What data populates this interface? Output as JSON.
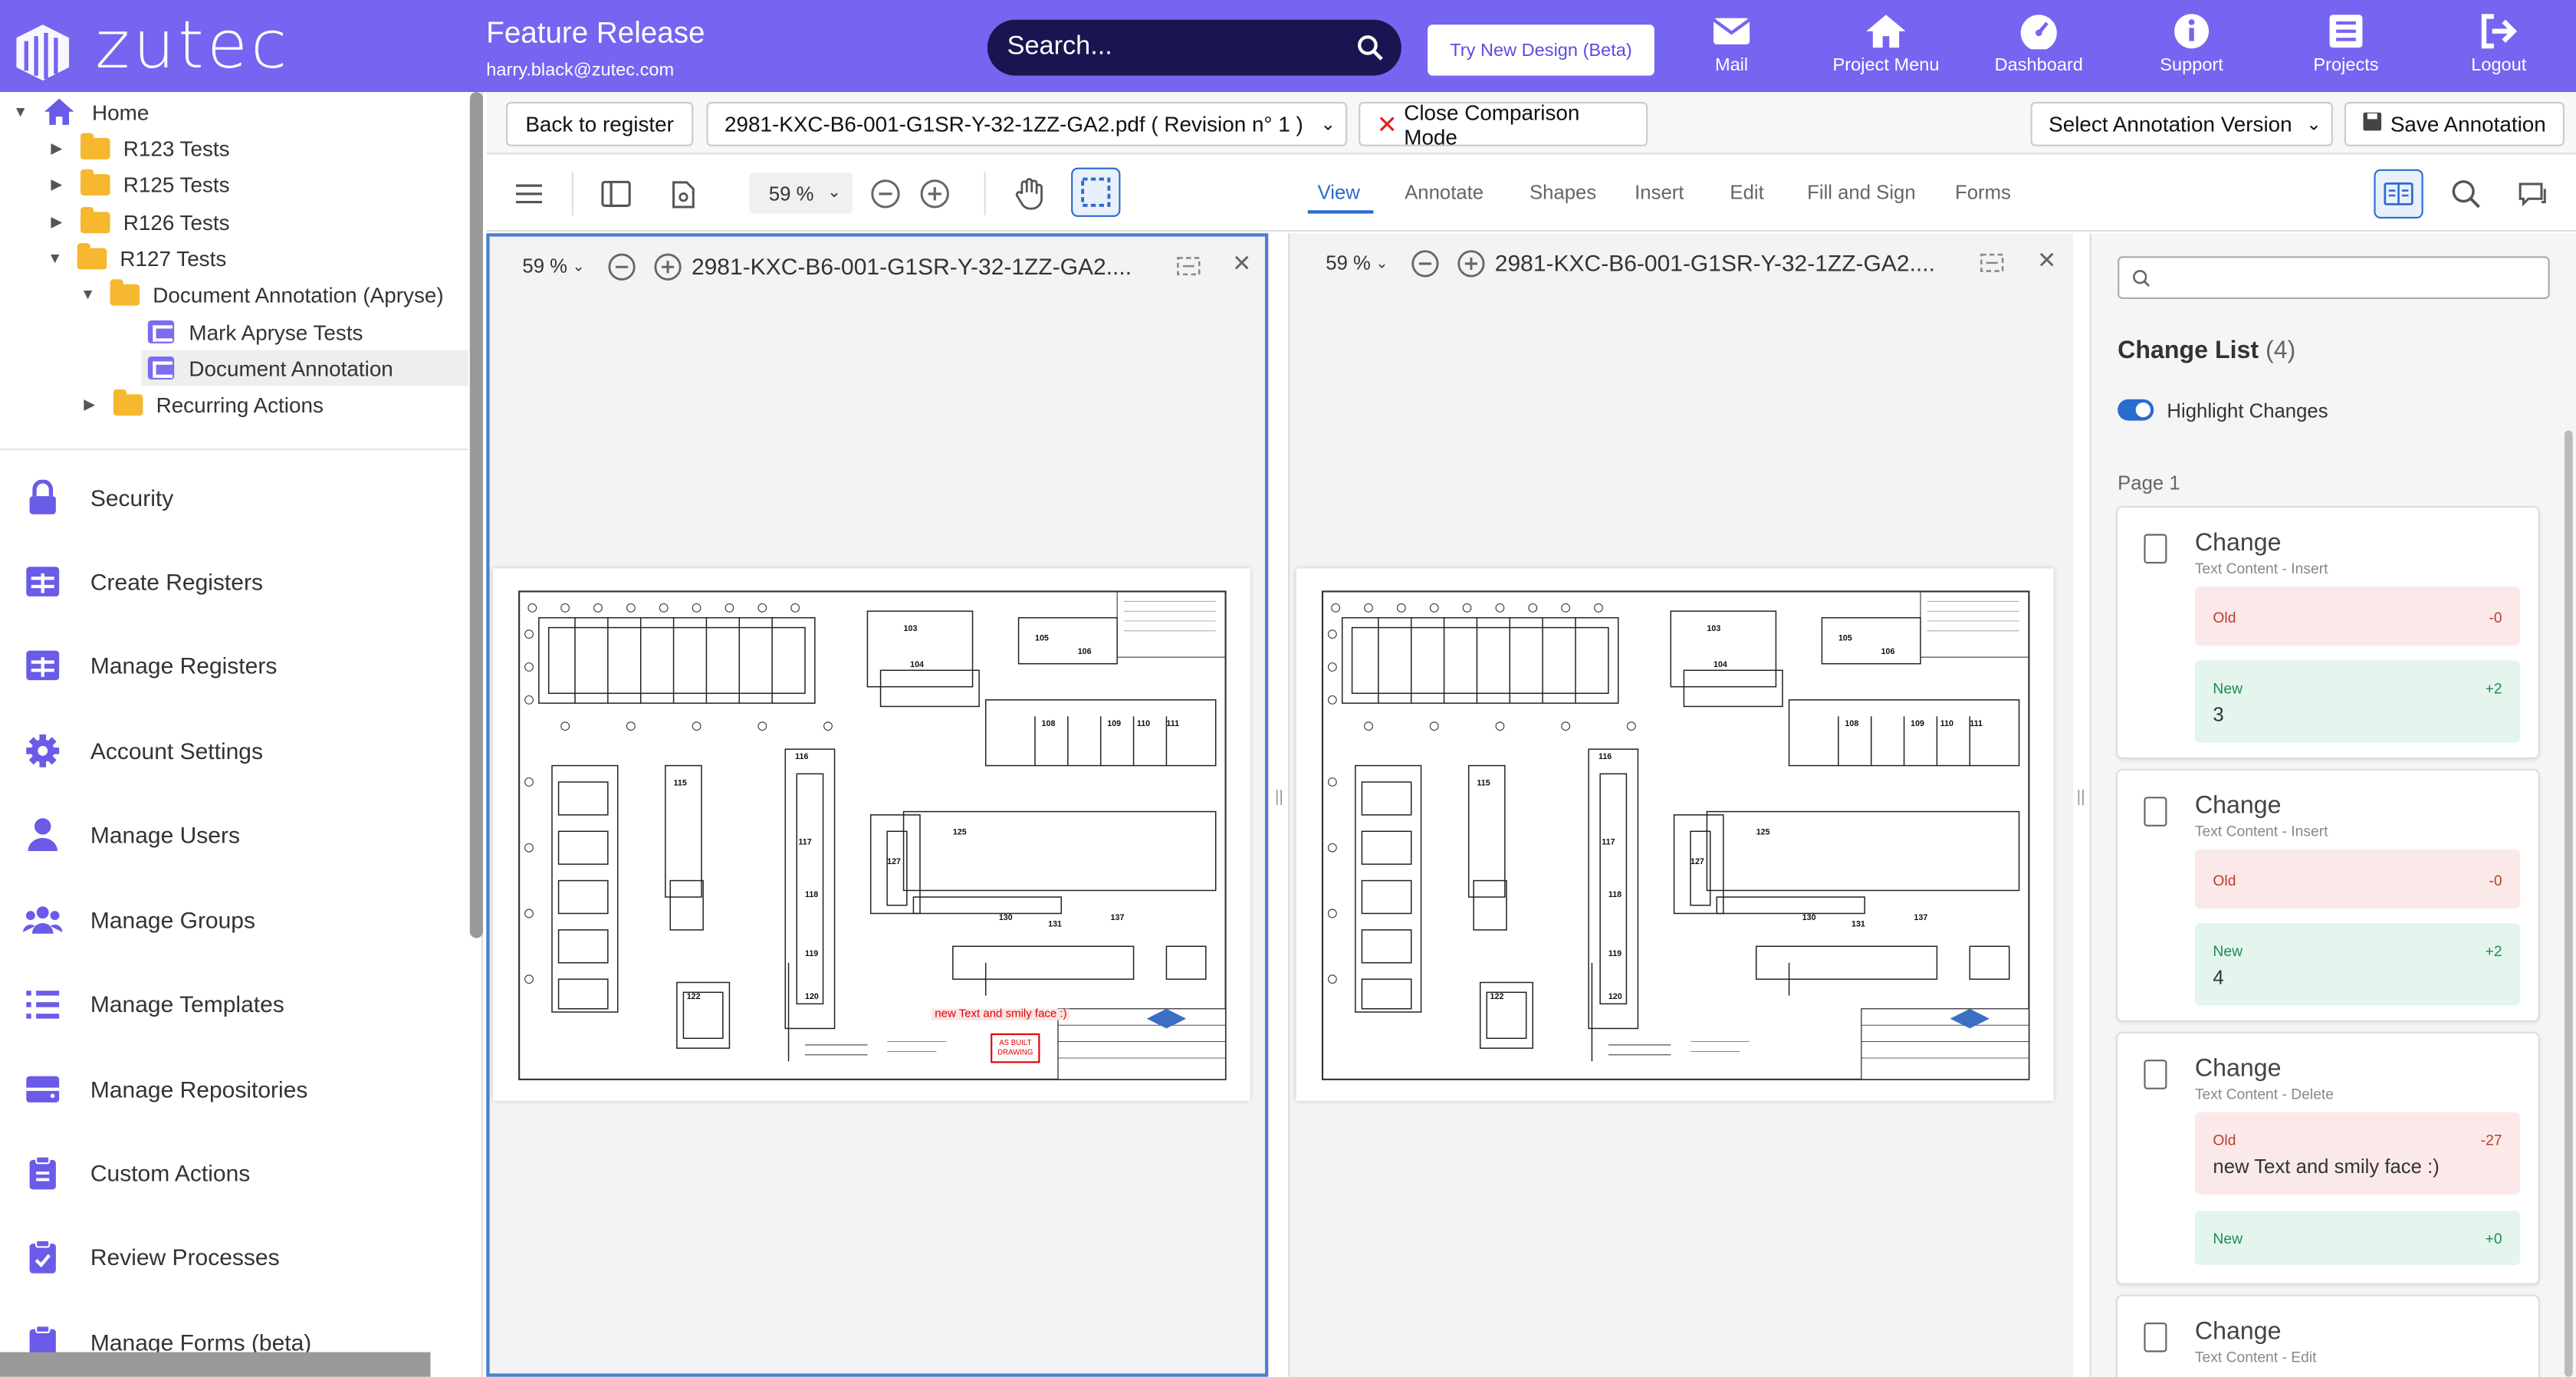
{
  "header": {
    "logo": "zutec",
    "project_title": "Feature Release",
    "user_email": "harry.black@zutec.com",
    "search_placeholder": "Search...",
    "try_new_design": "Try New Design (Beta)",
    "nav": [
      {
        "label": "Mail",
        "icon": "mail-icon"
      },
      {
        "label": "Project Menu",
        "icon": "home-icon"
      },
      {
        "label": "Dashboard",
        "icon": "dashboard-icon"
      },
      {
        "label": "Support",
        "icon": "info-icon"
      },
      {
        "label": "Projects",
        "icon": "list-icon"
      },
      {
        "label": "Logout",
        "icon": "logout-icon"
      }
    ]
  },
  "tree": {
    "items": [
      {
        "label": "Home"
      },
      {
        "label": "R123 Tests"
      },
      {
        "label": "R125 Tests"
      },
      {
        "label": "R126 Tests"
      },
      {
        "label": "R127 Tests"
      },
      {
        "label": "Document Annotation (Apryse)"
      },
      {
        "label": "Mark Apryse Tests"
      },
      {
        "label": "Document Annotation"
      },
      {
        "label": "Recurring Actions"
      }
    ]
  },
  "menu": {
    "items": [
      {
        "label": "Security"
      },
      {
        "label": "Create Registers"
      },
      {
        "label": "Manage Registers"
      },
      {
        "label": "Account Settings"
      },
      {
        "label": "Manage Users"
      },
      {
        "label": "Manage Groups"
      },
      {
        "label": "Manage Templates"
      },
      {
        "label": "Manage Repositories"
      },
      {
        "label": "Custom Actions"
      },
      {
        "label": "Review Processes"
      },
      {
        "label": "Manage Forms (beta)"
      }
    ]
  },
  "toolbar": {
    "back": "Back to register",
    "document": "2981-KXC-B6-001-G1SR-Y-32-1ZZ-GA2.pdf ( Revision n° 1 )",
    "close_comparison": "Close Comparison Mode",
    "annotation_version": "Select Annotation Version",
    "save_annotation": "Save Annotation"
  },
  "viewer": {
    "zoom": "59 %",
    "tabs": [
      "View",
      "Annotate",
      "Shapes",
      "Insert",
      "Edit",
      "Fill and Sign",
      "Forms"
    ],
    "active_tab": "View"
  },
  "panes": [
    {
      "zoom": "59 %",
      "title": "2981-KXC-B6-001-G1SR-Y-32-1ZZ-GA2....",
      "annotation": "new Text and smily face :)",
      "stamp_line1": "AS BUILT",
      "stamp_line2": "DRAWING"
    },
    {
      "zoom": "59 %",
      "title": "2981-KXC-B6-001-G1SR-Y-32-1ZZ-GA2...."
    }
  ],
  "changes": {
    "title": "Change List",
    "count": "(4)",
    "highlight_label": "Highlight Changes",
    "page_label": "Page 1",
    "cards": [
      {
        "title": "Change",
        "subtitle": "Text Content - Insert",
        "old_label": "Old",
        "old_count": "-0",
        "old_value": "",
        "new_label": "New",
        "new_count": "+2",
        "new_value": "3"
      },
      {
        "title": "Change",
        "subtitle": "Text Content - Insert",
        "old_label": "Old",
        "old_count": "-0",
        "old_value": "",
        "new_label": "New",
        "new_count": "+2",
        "new_value": "4"
      },
      {
        "title": "Change",
        "subtitle": "Text Content - Delete",
        "old_label": "Old",
        "old_count": "-27",
        "old_value": "new Text and smily face :)",
        "new_label": "New",
        "new_count": "+0",
        "new_value": ""
      },
      {
        "title": "Change",
        "subtitle": "Text Content - Edit"
      }
    ]
  },
  "drawing_labels": [
    "103",
    "104",
    "105",
    "106",
    "108",
    "109",
    "110",
    "111",
    "115",
    "116",
    "117",
    "118",
    "119",
    "120",
    "122",
    "125",
    "127",
    "130",
    "131",
    "137"
  ],
  "colors": {
    "brand": "#7565f0",
    "accent": "#2a6bd0",
    "old_bg": "#fbe9e9",
    "new_bg": "#e3f5ec"
  }
}
